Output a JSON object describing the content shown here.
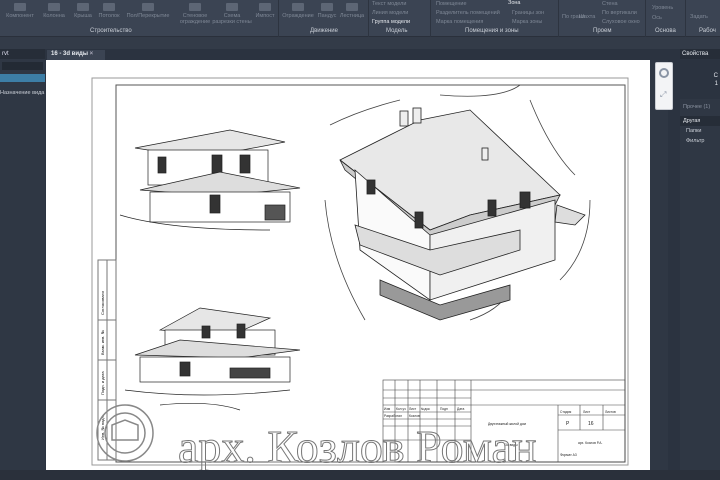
{
  "ribbon": {
    "buttons": [
      "Компонент",
      "Колонна",
      "Крыша",
      "Потолок",
      "Пол/Перекрытие",
      "Стеновое ограждение",
      "Схема разрезки стены",
      "Импост",
      "Ограждение",
      "Пандус",
      "Лестница"
    ],
    "model_items": [
      "Текст модели",
      "Линия модели",
      "Группа модели"
    ],
    "room_items": [
      "Помещение",
      "Разделитель помещений",
      "Марка помещения",
      "Зона",
      "Границы зон",
      "Марка зоны"
    ],
    "opening_items": [
      "По грани",
      "Шахта",
      "Стена",
      "По вертикали",
      "Слуховое окно"
    ],
    "datum_items": [
      "Уровень",
      "Ось"
    ],
    "work_items": [
      "Задать"
    ],
    "groups": [
      "Строительство",
      "Движение",
      "Модель",
      "Помещения и зоны",
      "Проем",
      "Основа",
      "Рабоч"
    ]
  },
  "project_browser": {
    "title": "rvt",
    "item": "Назначение вида"
  },
  "view_tab": {
    "label": "16 - 3d виды"
  },
  "properties": {
    "title": "Свойства",
    "type_line1": "С",
    "type_line2": "1",
    "selector": "Прочее (1)",
    "section": "Другая",
    "rows": [
      "Папки",
      "Фильтр"
    ]
  },
  "title_block": {
    "headers": [
      "Изм",
      "Кол.уч",
      "Лист",
      "№док",
      "Подп",
      "Дата"
    ],
    "developer_label": "Разработал",
    "developer": "Козлов",
    "building": "Двухэтажный жилой дом",
    "sheet_title": "3d виды",
    "stage_label": "Стадия",
    "sheet_label": "Лист",
    "sheets_label": "Листов",
    "stage": "Р",
    "sheet": "16",
    "author": "арх. Козлов Р.А.",
    "format_label": "Формат А3"
  },
  "side_stamps": [
    "Согласовано",
    "Взам. инв. №",
    "Подп. и дата",
    "Инв. № подл."
  ],
  "watermark": "арх. Козлов Роман"
}
